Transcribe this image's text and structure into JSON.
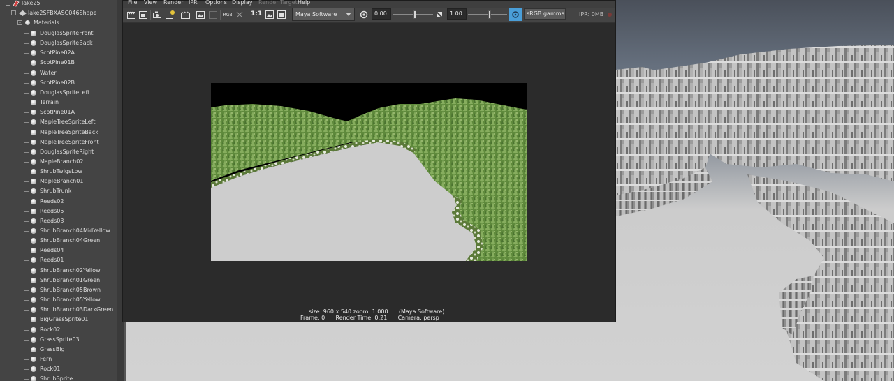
{
  "outliner": {
    "root": "lake25",
    "shape": "lake2SFBXASC046Shape",
    "materials_group": "Materials",
    "materials": [
      "DouglasSpriteFront",
      "DouglasSpriteBack",
      "ScotPine02A",
      "ScotPine01B",
      "Water",
      "ScotPine02B",
      "DouglasSpriteLeft",
      "Terrain",
      "ScotPine01A",
      "MapleTreeSpriteLeft",
      "MapleTreeSpriteBack",
      "MapleTreeSpriteFront",
      "DouglasSpriteRight",
      "MapleBranch02",
      "ShrubTwigsLow",
      "MapleBranch01",
      "ShrubTrunk",
      "Reeds02",
      "Reeds05",
      "Reeds03",
      "ShrubBranch04MidYellow",
      "ShrubBranch04Green",
      "Reeds04",
      "Reeds01",
      "ShrubBranch02Yellow",
      "ShrubBranch01Green",
      "ShrubBranch05Brown",
      "ShrubBranch05Yellow",
      "ShrubBranch03DarkGreen",
      "BigGrassSprite01",
      "Rock02",
      "GrassSprite03",
      "GrassBig",
      "Fern",
      "Rock01",
      "ShrubSprite"
    ]
  },
  "render_view": {
    "menu": {
      "file": "File",
      "view": "View",
      "render": "Render",
      "ipr": "IPR",
      "options": "Options",
      "display": "Display",
      "render_target": "Render Target",
      "help": "Help"
    },
    "toolbar": {
      "rgb_label": "RGB",
      "one_to_one": "1:1",
      "renderer": "Maya Software",
      "exposure": "0.00",
      "exposure_level": 0.55,
      "gamma": "1.00",
      "gamma_level": 0.55,
      "colorspace": "sRGB gamma",
      "ipr_memory": "IPR: 0MB"
    },
    "info": {
      "line1": "size: 960 x 540 zoom: 1.000      (Maya Software)",
      "line2": "Frame: 0      Render Time: 0:21      Camera: persp"
    }
  },
  "colors": {
    "accent": "#4a9ed8",
    "ipr_off": "#c0392b",
    "grass": "#6f9a4a",
    "water_render": "#cdcdcd"
  }
}
